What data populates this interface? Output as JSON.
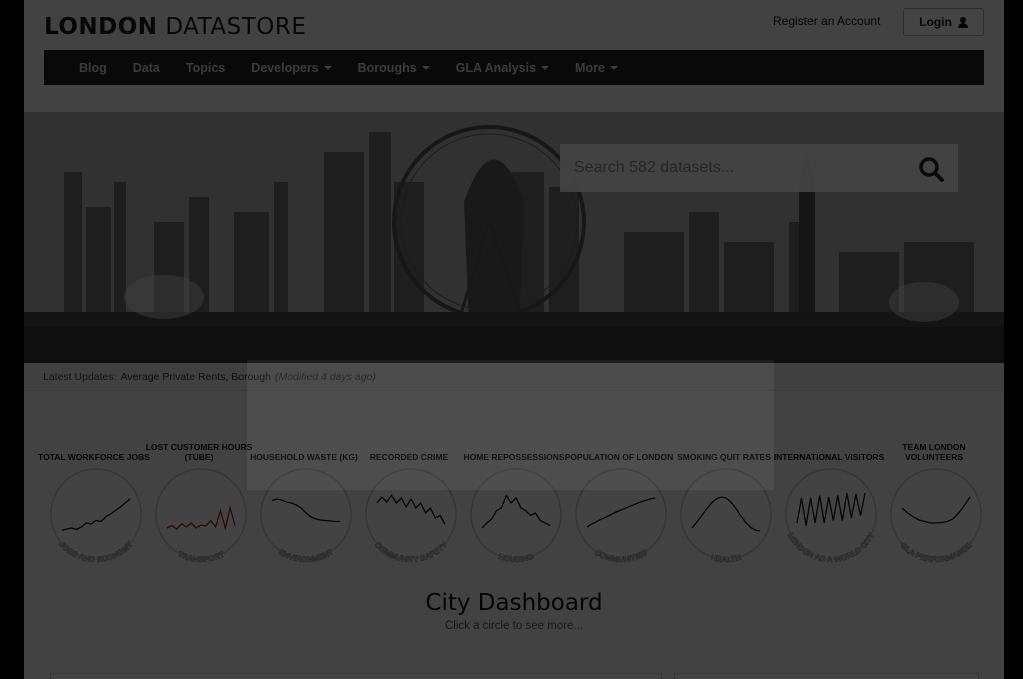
{
  "header": {
    "logo_bold": "LONDON",
    "logo_light": "DATASTORE",
    "register_label": "Register an Account",
    "login_label": "Login"
  },
  "nav": [
    {
      "label": "Blog",
      "dropdown": false
    },
    {
      "label": "Data",
      "dropdown": false
    },
    {
      "label": "Topics",
      "dropdown": false
    },
    {
      "label": "Developers",
      "dropdown": true
    },
    {
      "label": "Boroughs",
      "dropdown": true
    },
    {
      "label": "GLA Analysis",
      "dropdown": true
    },
    {
      "label": "More",
      "dropdown": true
    }
  ],
  "search": {
    "placeholder": "Search 582 datasets..."
  },
  "updates": {
    "prefix": "Latest Updates:",
    "link": "Average Private Rents, Borough",
    "modified": "(Modified 4 days ago)"
  },
  "dashboard": {
    "widgets": [
      {
        "title": "TOTAL WORKFORCE JOBS",
        "category": "JOBS AND ECONOMY",
        "sparkline": [
          0.15,
          0.18,
          0.2,
          0.17,
          0.22,
          0.3,
          0.28,
          0.35,
          0.33,
          0.42,
          0.48,
          0.55,
          0.62,
          0.7,
          0.78
        ],
        "color": "#111111"
      },
      {
        "title": "LOST CUSTOMER HOURS (TUBE)",
        "category": "TRANSPORT",
        "sparkline": [
          0.2,
          0.25,
          0.18,
          0.28,
          0.22,
          0.3,
          0.2,
          0.26,
          0.24,
          0.35,
          0.22,
          0.55,
          0.2,
          0.6,
          0.25
        ],
        "color": "#a02020"
      },
      {
        "title": "HOUSEHOLD WASTE (KG)",
        "category": "ENVIRONMENT",
        "sparkline": [
          0.75,
          0.78,
          0.76,
          0.72,
          0.7,
          0.66,
          0.6,
          0.5,
          0.42,
          0.38,
          0.36,
          0.35,
          0.34,
          0.33,
          0.33
        ],
        "color": "#111111"
      },
      {
        "title": "RECORDED CRIME",
        "category": "COMMUNITY SAFETY",
        "sparkline": [
          0.7,
          0.82,
          0.72,
          0.85,
          0.7,
          0.8,
          0.62,
          0.78,
          0.6,
          0.7,
          0.5,
          0.6,
          0.4,
          0.45,
          0.28
        ],
        "color": "#111111"
      },
      {
        "title": "HOME REPOSSESSIONS",
        "category": "HOUSING",
        "sparkline": [
          0.2,
          0.3,
          0.38,
          0.55,
          0.6,
          0.85,
          0.7,
          0.8,
          0.6,
          0.55,
          0.45,
          0.5,
          0.35,
          0.3,
          0.25
        ],
        "color": "#111111"
      },
      {
        "title": "POPULATION OF LONDON",
        "category": "COMMUNITIES",
        "sparkline": [
          0.22,
          0.28,
          0.33,
          0.38,
          0.42,
          0.47,
          0.52,
          0.56,
          0.6,
          0.64,
          0.68,
          0.72,
          0.75,
          0.78,
          0.8
        ],
        "color": "#111111"
      },
      {
        "title": "SMOKING QUIT RATES",
        "category": "HEALTH",
        "sparkline": [
          0.2,
          0.32,
          0.45,
          0.58,
          0.7,
          0.78,
          0.82,
          0.8,
          0.72,
          0.6,
          0.45,
          0.32,
          0.22,
          0.16,
          0.14
        ],
        "color": "#111111"
      },
      {
        "title": "INTERNATIONAL VISITORS",
        "category": "LONDON AS A WORLD CITY",
        "sparkline": [
          0.3,
          0.8,
          0.25,
          0.8,
          0.3,
          0.85,
          0.3,
          0.82,
          0.35,
          0.85,
          0.35,
          0.9,
          0.4,
          0.88,
          0.45,
          0.9
        ],
        "color": "#111111"
      },
      {
        "title": "TEAM LONDON VOLUNTEERS",
        "category": "GLA PERFORMANCE",
        "sparkline": [
          0.6,
          0.5,
          0.42,
          0.36,
          0.33,
          0.3,
          0.3,
          0.31,
          0.33,
          0.38,
          0.5,
          0.65,
          0.82
        ],
        "color": "#111111"
      }
    ]
  },
  "city": {
    "title": "City Dashboard",
    "subtitle": "Click a circle to see more..."
  }
}
